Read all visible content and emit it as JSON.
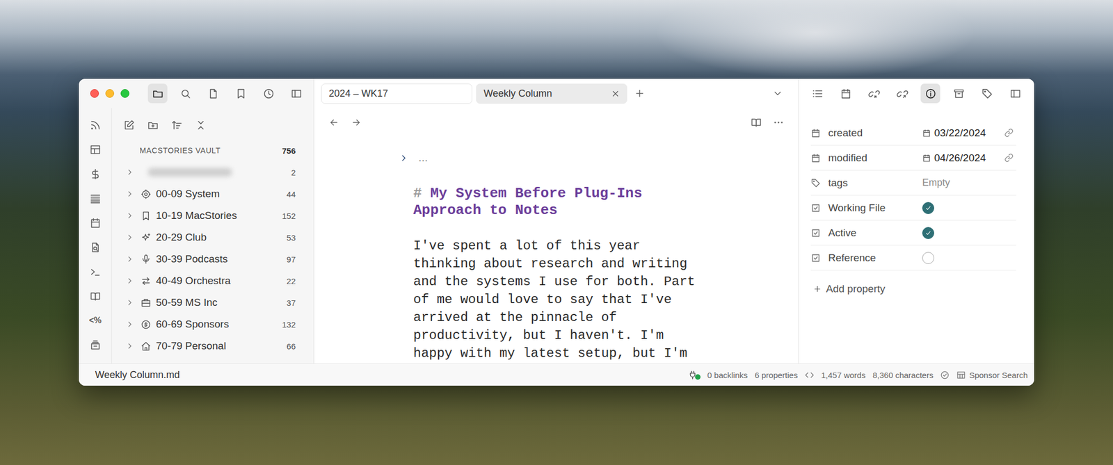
{
  "left_toolbar": [
    {
      "selected": true
    },
    {
      "selected": false
    },
    {
      "selected": false
    },
    {
      "selected": false
    },
    {
      "selected": false
    },
    {
      "selected": false
    }
  ],
  "ribbon": [
    {
      "kind": "icon"
    },
    {
      "kind": "icon"
    },
    {
      "kind": "icon"
    },
    {
      "kind": "icon"
    },
    {
      "kind": "icon"
    },
    {
      "kind": "icon"
    },
    {
      "kind": "icon"
    },
    {
      "kind": "icon"
    },
    {
      "kind": "glyph",
      "glyph": "<%"
    },
    {
      "kind": "icon"
    }
  ],
  "sidebar": {
    "vault": {
      "name": "MACSTORIES VAULT",
      "count": "756"
    },
    "items": [
      {
        "blurred": true,
        "count": "2",
        "expanded": false
      },
      {
        "blurred": false,
        "label": "00-09 System",
        "count": "44",
        "expanded": false
      },
      {
        "blurred": false,
        "label": "10-19 MacStories",
        "count": "152",
        "expanded": false
      },
      {
        "blurred": false,
        "label": "20-29 Club",
        "count": "53",
        "expanded": false
      },
      {
        "blurred": false,
        "label": "30-39 Podcasts",
        "count": "97",
        "expanded": false
      },
      {
        "blurred": false,
        "label": "40-49 Orchestra",
        "count": "22",
        "expanded": false
      },
      {
        "blurred": false,
        "label": "50-59 MS Inc",
        "count": "37",
        "expanded": false
      },
      {
        "blurred": false,
        "label": "60-69 Sponsors",
        "count": "132",
        "expanded": false
      },
      {
        "blurred": false,
        "label": "70-79 Personal",
        "count": "66",
        "expanded": false
      }
    ]
  },
  "tabs": [
    {
      "label": "2024 – WK17",
      "selected": false,
      "closable": false
    },
    {
      "label": "Weekly Column",
      "selected": true,
      "closable": true
    }
  ],
  "editor": {
    "fold": {
      "expanded": false,
      "ellipsis": "…"
    },
    "heading": {
      "marker": "#",
      "text": "My System Before Plug-Ins Approach to Notes"
    },
    "body": "I've spent a lot of this year thinking about research and writing and the systems I use for both. Part of me would love to say that I've arrived at the pinnacle of productivity, but I haven't. I'm happy with my latest setup, but I'm"
  },
  "right_toolbar": [
    {
      "selected": false
    },
    {
      "selected": false
    },
    {
      "selected": false
    },
    {
      "selected": false
    },
    {
      "selected": true
    },
    {
      "selected": false
    },
    {
      "selected": false
    },
    {
      "selected": false
    }
  ],
  "properties": [
    {
      "kind": "date",
      "name": "created",
      "value": "03/22/2024"
    },
    {
      "kind": "date",
      "name": "modified",
      "value": "04/26/2024"
    },
    {
      "kind": "tags",
      "name": "tags",
      "value": "Empty",
      "empty": true
    },
    {
      "kind": "checkbox",
      "name": "Working File",
      "checked": true
    },
    {
      "kind": "checkbox",
      "name": "Active",
      "checked": true
    },
    {
      "kind": "checkbox",
      "name": "Reference",
      "checked": false
    }
  ],
  "add_property": "Add property",
  "status_bar": {
    "file": "Weekly Column.md",
    "sync_ok": true,
    "backlinks": "0 backlinks",
    "properties": "6 properties",
    "words": "1,457 words",
    "characters": "8,360 characters",
    "search": "Sponsor Search"
  }
}
